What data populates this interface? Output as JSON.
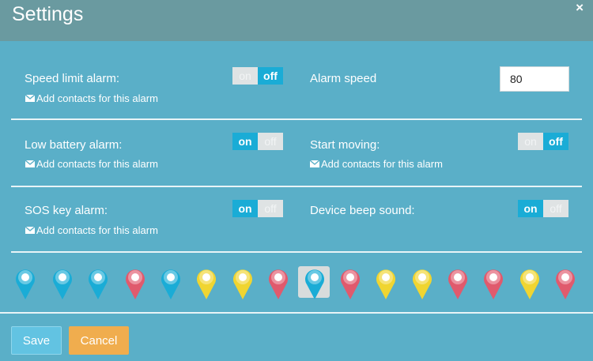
{
  "window": {
    "title": "Settings",
    "close_glyph": "×"
  },
  "settings": {
    "speed_limit": {
      "label": "Speed limit alarm:",
      "contacts": "Add contacts for this alarm",
      "state": "off"
    },
    "alarm_speed": {
      "label": "Alarm speed",
      "value": "80"
    },
    "low_battery": {
      "label": "Low battery alarm:",
      "contacts": "Add contacts for this alarm",
      "state": "on"
    },
    "start_moving": {
      "label": "Start moving:",
      "contacts": "Add contacts for this alarm",
      "state": "off"
    },
    "sos_key": {
      "label": "SOS key alarm:",
      "contacts": "Add contacts for this alarm",
      "state": "on"
    },
    "beep_sound": {
      "label": "Device beep sound:",
      "state": "on"
    }
  },
  "toggle": {
    "on_label": "on",
    "off_label": "off"
  },
  "pins": [
    {
      "icon": "face-icon",
      "color": "#1aacd6"
    },
    {
      "icon": "paw-icon",
      "color": "#1aacd6"
    },
    {
      "icon": "ball-icon",
      "color": "#1aacd6"
    },
    {
      "icon": "rocket-icon",
      "color": "#e05a6d"
    },
    {
      "icon": "star-icon",
      "color": "#1aacd6"
    },
    {
      "icon": "walker-icon",
      "color": "#f0d531"
    },
    {
      "icon": "bus-icon",
      "color": "#f0d531"
    },
    {
      "icon": "mouse-icon",
      "color": "#e05a6d"
    },
    {
      "icon": "lips-icon",
      "color": "#1aacd6",
      "selected": true
    },
    {
      "icon": "cloud-icon",
      "color": "#e05a6d"
    },
    {
      "icon": "target-icon",
      "color": "#f0d531"
    },
    {
      "icon": "eye-icon",
      "color": "#f0d531"
    },
    {
      "icon": "heart-icon",
      "color": "#e05a6d"
    },
    {
      "icon": "mustache-icon",
      "color": "#e05a6d"
    },
    {
      "icon": "key-icon",
      "color": "#f0d531"
    },
    {
      "icon": "location-icon",
      "color": "#e05a6d"
    }
  ],
  "buttons": {
    "save": "Save",
    "cancel": "Cancel"
  },
  "colors": {
    "accent": "#1aacd6",
    "background": "#5aafc8",
    "header": "#6a9aa0",
    "cancel": "#f0ad4e"
  }
}
